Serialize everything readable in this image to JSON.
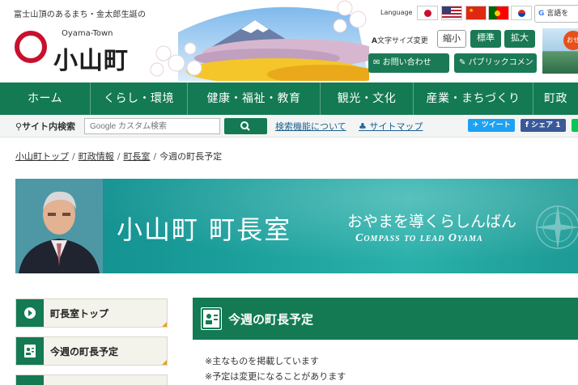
{
  "header": {
    "tagline": "富士山頂のあるまち・金太郎生誕の地、静岡県小山町",
    "logo_sub": "Oyama-Town",
    "logo_main": "小山町",
    "language_label": "Language",
    "translate_label": "言語を",
    "font_size_label": "文字サイズ変更",
    "font_sizes": [
      "縮小",
      "標準",
      "拡大"
    ],
    "contact_label": "お問い合わせ",
    "public_comment_label": "パブリックコメント",
    "thumb_badge": "おせ"
  },
  "nav": {
    "items": [
      "ホーム",
      "くらし・環境",
      "健康・福祉・教育",
      "観光・文化",
      "産業・まちづくり",
      "町政"
    ]
  },
  "search": {
    "label": "サイト内検索",
    "placeholder": "Google カスタム検索",
    "help_link": "検索機能について",
    "sitemap_link": "サイトマップ",
    "tweet_label": "ツイート",
    "share_label": "シェア 1"
  },
  "breadcrumb": {
    "items": [
      "小山町トップ",
      "町政情報",
      "町長室"
    ],
    "current": "今週の町長予定"
  },
  "banner": {
    "title": "小山町 町長室",
    "slogan": "おやまを導くらしんばん",
    "subtitle": "Compass to lead Oyama"
  },
  "sidebar": {
    "items": [
      "町長室トップ",
      "今週の町長予定"
    ]
  },
  "main": {
    "title": "今週の町長予定",
    "notes": [
      "※主なものを掲載しています",
      "※予定は変更になることがあります"
    ]
  },
  "colors": {
    "brand_green": "#137a54",
    "logo_red": "#c8102e",
    "banner_teal": "#1a9d9a",
    "accent_orange": "#e8a323"
  }
}
